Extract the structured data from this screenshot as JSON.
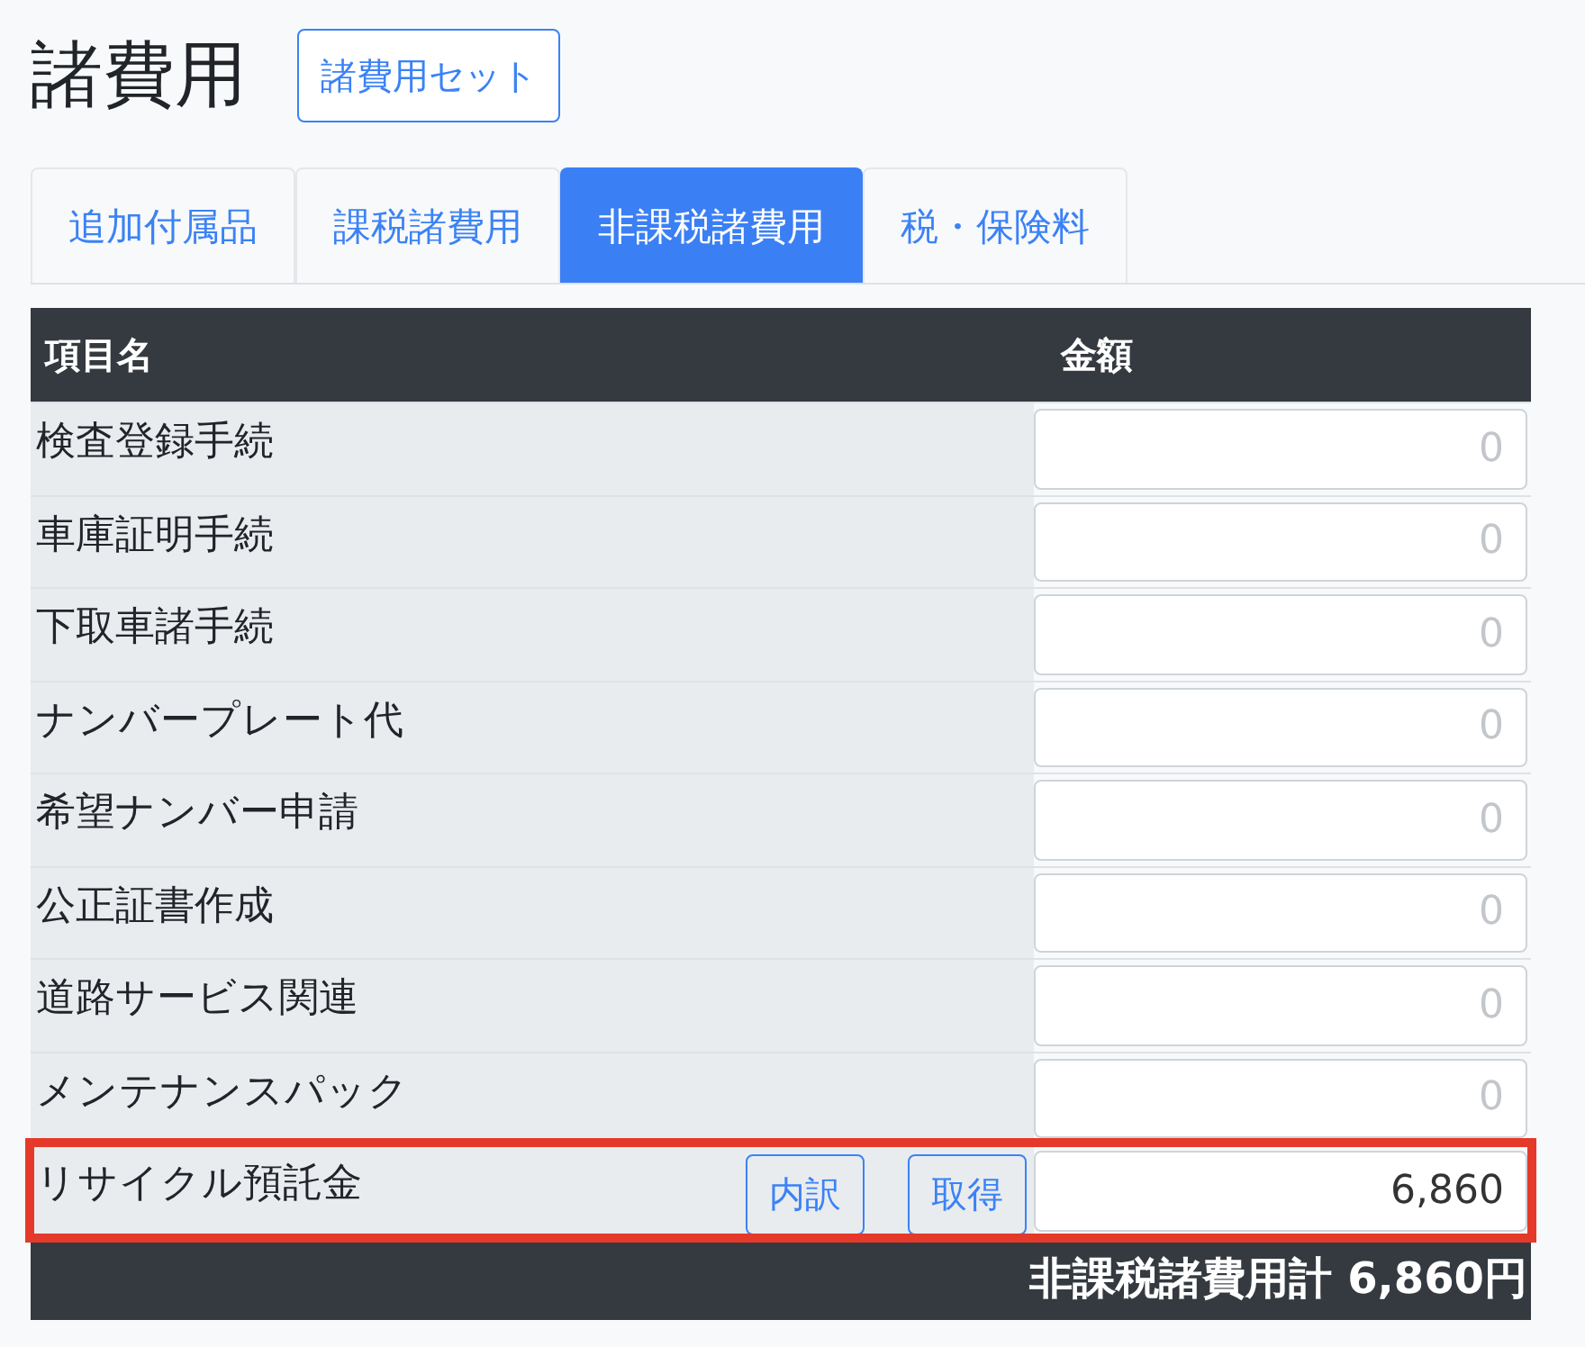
{
  "title": "諸費用",
  "set_button": "諸費用セット",
  "tabs": [
    {
      "label": "追加付属品",
      "selected": false
    },
    {
      "label": "課税諸費用",
      "selected": false
    },
    {
      "label": "非課税諸費用",
      "selected": true
    },
    {
      "label": "税・保険料",
      "selected": false
    }
  ],
  "table": {
    "columns": [
      "項目名",
      "金額"
    ],
    "rows": [
      {
        "label": "検査登録手続",
        "placeholder": "0",
        "highlighted": false
      },
      {
        "label": "車庫証明手続",
        "placeholder": "0",
        "highlighted": false
      },
      {
        "label": "下取車諸手続",
        "placeholder": "0",
        "highlighted": false
      },
      {
        "label": "ナンバープレート代",
        "placeholder": "0",
        "highlighted": false
      },
      {
        "label": "希望ナンバー申請",
        "placeholder": "0",
        "highlighted": false
      },
      {
        "label": "公正証書作成",
        "placeholder": "0",
        "highlighted": false
      },
      {
        "label": "道路サービス関連",
        "placeholder": "0",
        "highlighted": false
      },
      {
        "label": "メンテナンスパック",
        "placeholder": "0",
        "highlighted": false
      },
      {
        "label": "リサイクル預託金",
        "value": "6,860",
        "buttons": [
          "内訳",
          "取得"
        ],
        "highlighted": true
      }
    ],
    "total": "非課税諸費用計 6,860円"
  }
}
